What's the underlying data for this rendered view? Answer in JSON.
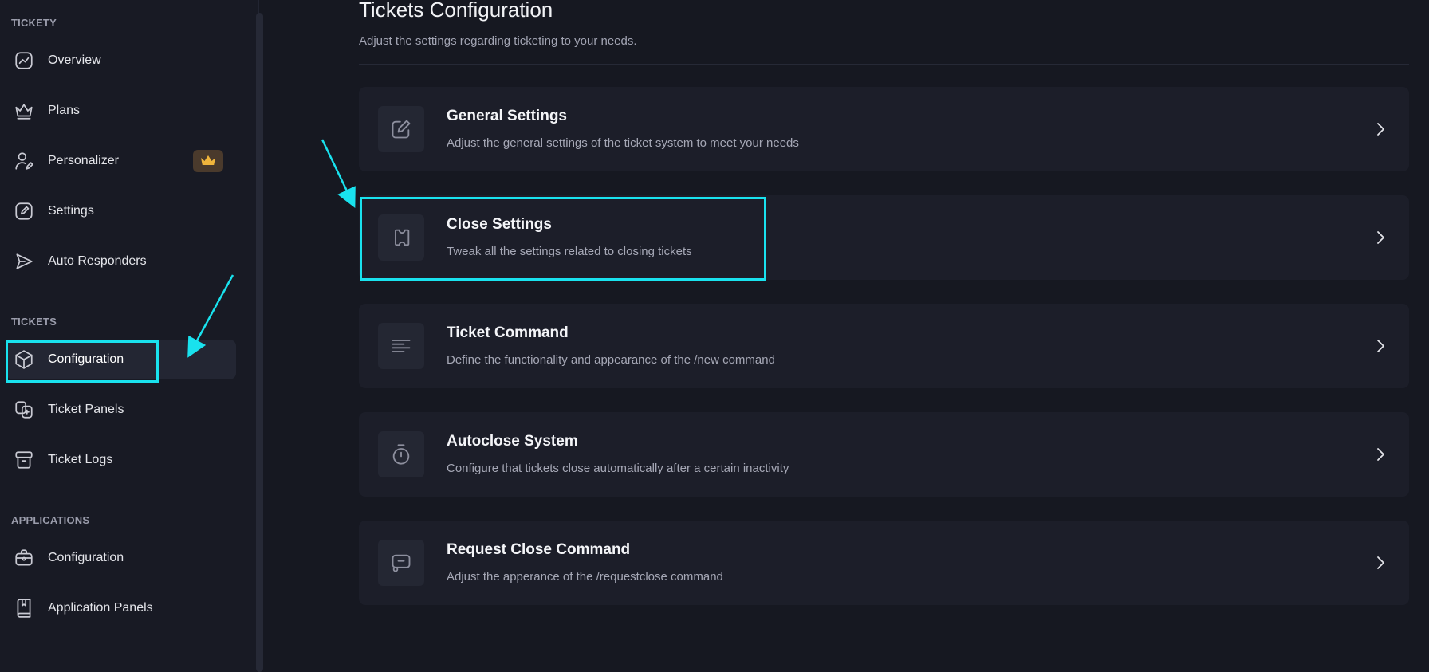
{
  "sidebar": {
    "sections": [
      {
        "title": "TICKETY"
      },
      {
        "title": "TICKETS"
      },
      {
        "title": "APPLICATIONS"
      }
    ],
    "items": [
      {
        "label": "Overview",
        "icon": "chart-line-icon"
      },
      {
        "label": "Plans",
        "icon": "crown-icon"
      },
      {
        "label": "Personalizer",
        "icon": "user-edit-icon",
        "badge": "crown-badge-icon"
      },
      {
        "label": "Settings",
        "icon": "pencil-square-icon"
      },
      {
        "label": "Auto Responders",
        "icon": "send-icon"
      },
      {
        "label": "Configuration",
        "icon": "cube-icon",
        "active": true
      },
      {
        "label": "Ticket Panels",
        "icon": "copy-plus-icon"
      },
      {
        "label": "Ticket Logs",
        "icon": "archive-icon"
      },
      {
        "label": "Configuration",
        "icon": "briefcase-icon"
      },
      {
        "label": "Application Panels",
        "icon": "book-icon"
      }
    ]
  },
  "main": {
    "title": "Tickets Configuration",
    "subtitle": "Adjust the settings regarding ticketing to your needs.",
    "cards": [
      {
        "title": "General Settings",
        "description": "Adjust the general settings of the ticket system to meet your needs",
        "icon": "edit-icon"
      },
      {
        "title": "Close Settings",
        "description": "Tweak all the settings related to closing tickets",
        "icon": "ticket-icon"
      },
      {
        "title": "Ticket Command",
        "description": "Define the functionality and appearance of the /new command",
        "icon": "align-left-icon"
      },
      {
        "title": "Autoclose System",
        "description": "Configure that tickets close automatically after a certain inactivity",
        "icon": "stopwatch-icon"
      },
      {
        "title": "Request Close Command",
        "description": "Adjust the apperance of the /requestclose command",
        "icon": "message-icon"
      }
    ]
  },
  "colors": {
    "background": "#161821",
    "card": "#1c1e29",
    "highlight": "#19e2ee",
    "badge": "#4a3a2c",
    "crown": "#f0b53c"
  }
}
